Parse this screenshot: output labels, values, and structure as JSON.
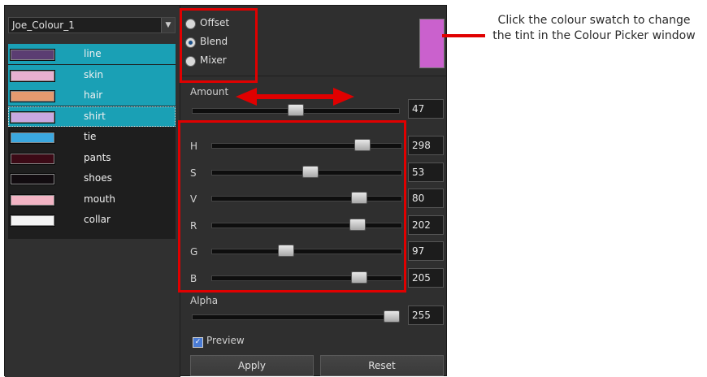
{
  "palette": {
    "name": "Joe_Colour_1"
  },
  "colours": [
    {
      "label": "line",
      "color": "#5b3d72"
    },
    {
      "label": "skin",
      "color": "#e8b0d0"
    },
    {
      "label": "hair",
      "color": "#e49a6f"
    },
    {
      "label": "shirt",
      "color": "#c8a8e0"
    },
    {
      "label": "tie",
      "color": "#3ba8e0"
    },
    {
      "label": "pants",
      "color": "#3c0a16"
    },
    {
      "label": "shoes",
      "color": "#120c10"
    },
    {
      "label": "mouth",
      "color": "#f2b4c4"
    },
    {
      "label": "collar",
      "color": "#f4f4f4"
    }
  ],
  "selected_indices": [
    0,
    1,
    2,
    3
  ],
  "focused_index": 3,
  "mode": {
    "options": [
      "Offset",
      "Blend",
      "Mixer"
    ],
    "selected": "Blend"
  },
  "tint_swatch_color": "#ca61cd",
  "amount": {
    "label": "Amount",
    "value": "47",
    "fraction": 0.5
  },
  "sliders": [
    {
      "label": "H",
      "value": "298",
      "fraction": 0.82
    },
    {
      "label": "S",
      "value": "53",
      "fraction": 0.52
    },
    {
      "label": "V",
      "value": "80",
      "fraction": 0.8
    },
    {
      "label": "R",
      "value": "202",
      "fraction": 0.79
    },
    {
      "label": "G",
      "value": "97",
      "fraction": 0.38
    },
    {
      "label": "B",
      "value": "205",
      "fraction": 0.8
    }
  ],
  "alpha": {
    "label": "Alpha",
    "value": "255",
    "fraction": 1.0
  },
  "preview": {
    "label": "Preview",
    "checked": true
  },
  "buttons": {
    "apply": "Apply",
    "reset": "Reset"
  },
  "callout_text": "Click the colour swatch to change the tint in the Colour Picker window",
  "highlight_color": "#e00000"
}
